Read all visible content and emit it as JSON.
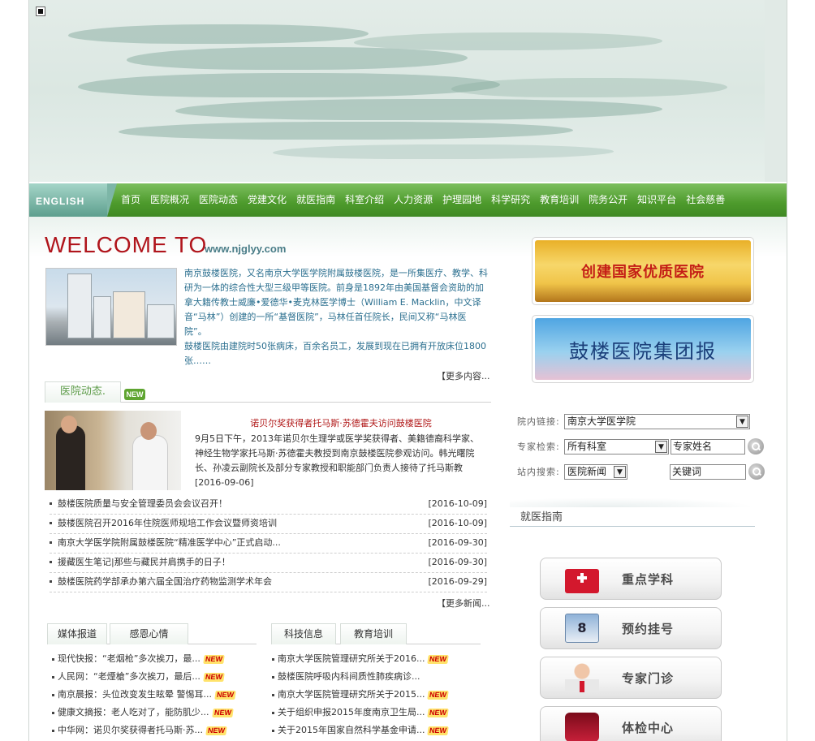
{
  "nav": {
    "english": "ENGLISH",
    "items": [
      "首页",
      "医院概况",
      "医院动态",
      "党建文化",
      "就医指南",
      "科室介绍",
      "人力资源",
      "护理园地",
      "科学研究",
      "教育培训",
      "院务公开",
      "知识平台",
      "社会慈善"
    ]
  },
  "welcome": {
    "title": "WELCOME TO",
    "url": "www.njglyy.com",
    "intro_p1": "南京鼓楼医院，又名南京大学医学院附属鼓楼医院，是一所集医疗、教学、科研为一体的综合性大型三级甲等医院。前身是1892年由美国基督会资助的加拿大籍传教士威廉•爱德华•麦克林医学博士（William E. Macklin，中文译音“马林”）创建的一所“基督医院”，马林任首任院长，民间又称“马林医院”。",
    "intro_p2": "鼓楼医院由建院时50张病床，百余名员工，发展到现在已拥有开放床位1800张……",
    "more": "【更多内容..."
  },
  "news": {
    "tab": "医院动态.",
    "new_badge": "NEW",
    "headline_title": "诺贝尔奖获得者托马斯·苏德霍夫访问鼓楼医院",
    "headline_body": "9月5日下午，2013年诺贝尔生理学或医学奖获得者、美籍德裔科学家、神经生物学家托马斯·苏德霍夫教授到南京鼓楼医院参观访问。韩光曙院长、孙凌云副院长及部分专家教授和职能部门负责人接待了托马斯教",
    "headline_date": "[2016-09-06]",
    "items": [
      {
        "title": "鼓楼医院质量与安全管理委员会会议召开！",
        "date": "[2016-10-09]"
      },
      {
        "title": "鼓楼医院召开2016年住院医师规培工作会议暨师资培训",
        "date": "[2016-10-09]"
      },
      {
        "title": "南京大学医学院附属鼓楼医院“精准医学中心”正式启动...",
        "date": "[2016-09-30]"
      },
      {
        "title": "援藏医生笔记|那些与藏民并肩携手的日子！",
        "date": "[2016-09-30]"
      },
      {
        "title": "鼓楼医院药学部承办第六届全国治疗药物监测学术年会",
        "date": "[2016-09-29]"
      }
    ],
    "more": "【更多新闻..."
  },
  "media": {
    "tabs": [
      "媒体报道",
      "感恩心情"
    ],
    "items": [
      "现代快报：“老烟枪”多次挨刀，最...",
      "人民网：“老煙槍”多次挨刀，最后...",
      "南京晨报：头位改变发生眩晕 警惕耳...",
      "健康文摘报：老人吃对了，能防肌少...",
      "中华网：诺贝尔奖获得者托马斯·苏..."
    ]
  },
  "science": {
    "tabs": [
      "科技信息",
      "教育培训"
    ],
    "items": [
      "南京大学医院管理研究所关于2016...",
      "鼓楼医院呼吸内科间质性肺疾病诊...",
      "南京大学医院管理研究所关于2015...",
      "关于组织申报2015年度南京卫生局...",
      "关于2015年国家自然科学基金申请..."
    ]
  },
  "ads": {
    "ad1": "创建国家优质医院",
    "ad2": "鼓楼医院集团报"
  },
  "search": {
    "link_label": "院内链接:",
    "link_value": "南京大学医学院",
    "expert_label": "专家检索:",
    "dept_value": "所有科室",
    "expert_name": "专家姓名",
    "site_label": "站内搜索:",
    "site_value": "医院新闻",
    "keyword": "关键词"
  },
  "guide": {
    "title": "就医指南",
    "buttons": [
      "重点学科",
      "预约挂号",
      "专家门诊",
      "体检中心"
    ]
  }
}
